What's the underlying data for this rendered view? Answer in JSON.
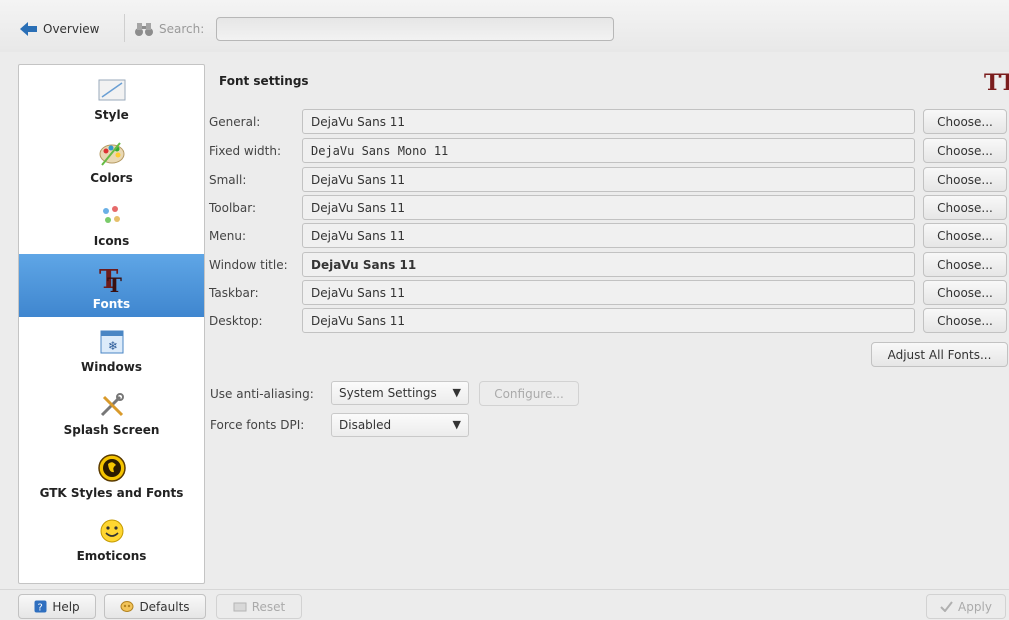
{
  "toolbar": {
    "overview_label": "Overview",
    "search_label": "Search:",
    "search_value": ""
  },
  "sidebar": {
    "items": [
      {
        "label": "Style",
        "icon": "style-icon"
      },
      {
        "label": "Colors",
        "icon": "colors-icon"
      },
      {
        "label": "Icons",
        "icon": "icons-icon"
      },
      {
        "label": "Fonts",
        "icon": "fonts-icon",
        "selected": true
      },
      {
        "label": "Windows",
        "icon": "windows-icon"
      },
      {
        "label": "Splash Screen",
        "icon": "splash-screen-icon"
      },
      {
        "label": "GTK Styles and Fonts",
        "icon": "gtk-icon"
      },
      {
        "label": "Emoticons",
        "icon": "emoticons-icon"
      }
    ]
  },
  "panel": {
    "title": "Font settings",
    "title_icon": "TT"
  },
  "fonts": [
    {
      "label": "General:",
      "value": "DejaVu Sans 11"
    },
    {
      "label": "Fixed width:",
      "value": "DejaVu Sans Mono 11"
    },
    {
      "label": "Small:",
      "value": "DejaVu Sans 11"
    },
    {
      "label": "Toolbar:",
      "value": "DejaVu Sans 11"
    },
    {
      "label": "Menu:",
      "value": "DejaVu Sans 11"
    },
    {
      "label": "Window title:",
      "value": "DejaVu Sans 11"
    },
    {
      "label": "Taskbar:",
      "value": "DejaVu Sans 11"
    },
    {
      "label": "Desktop:",
      "value": "DejaVu Sans 11"
    }
  ],
  "choose_label": "Choose...",
  "adjust_all_label": "Adjust All Fonts...",
  "antialias": {
    "label": "Use anti-aliasing:",
    "value": "System Settings",
    "configure_label": "Configure..."
  },
  "dpi": {
    "label": "Force fonts DPI:",
    "value": "Disabled"
  },
  "footer": {
    "help_label": "Help",
    "defaults_label": "Defaults",
    "reset_label": "Reset",
    "apply_label": "Apply"
  },
  "colors": {
    "selection": "#3f86cf",
    "tt_icon": "#7b1d1d"
  }
}
